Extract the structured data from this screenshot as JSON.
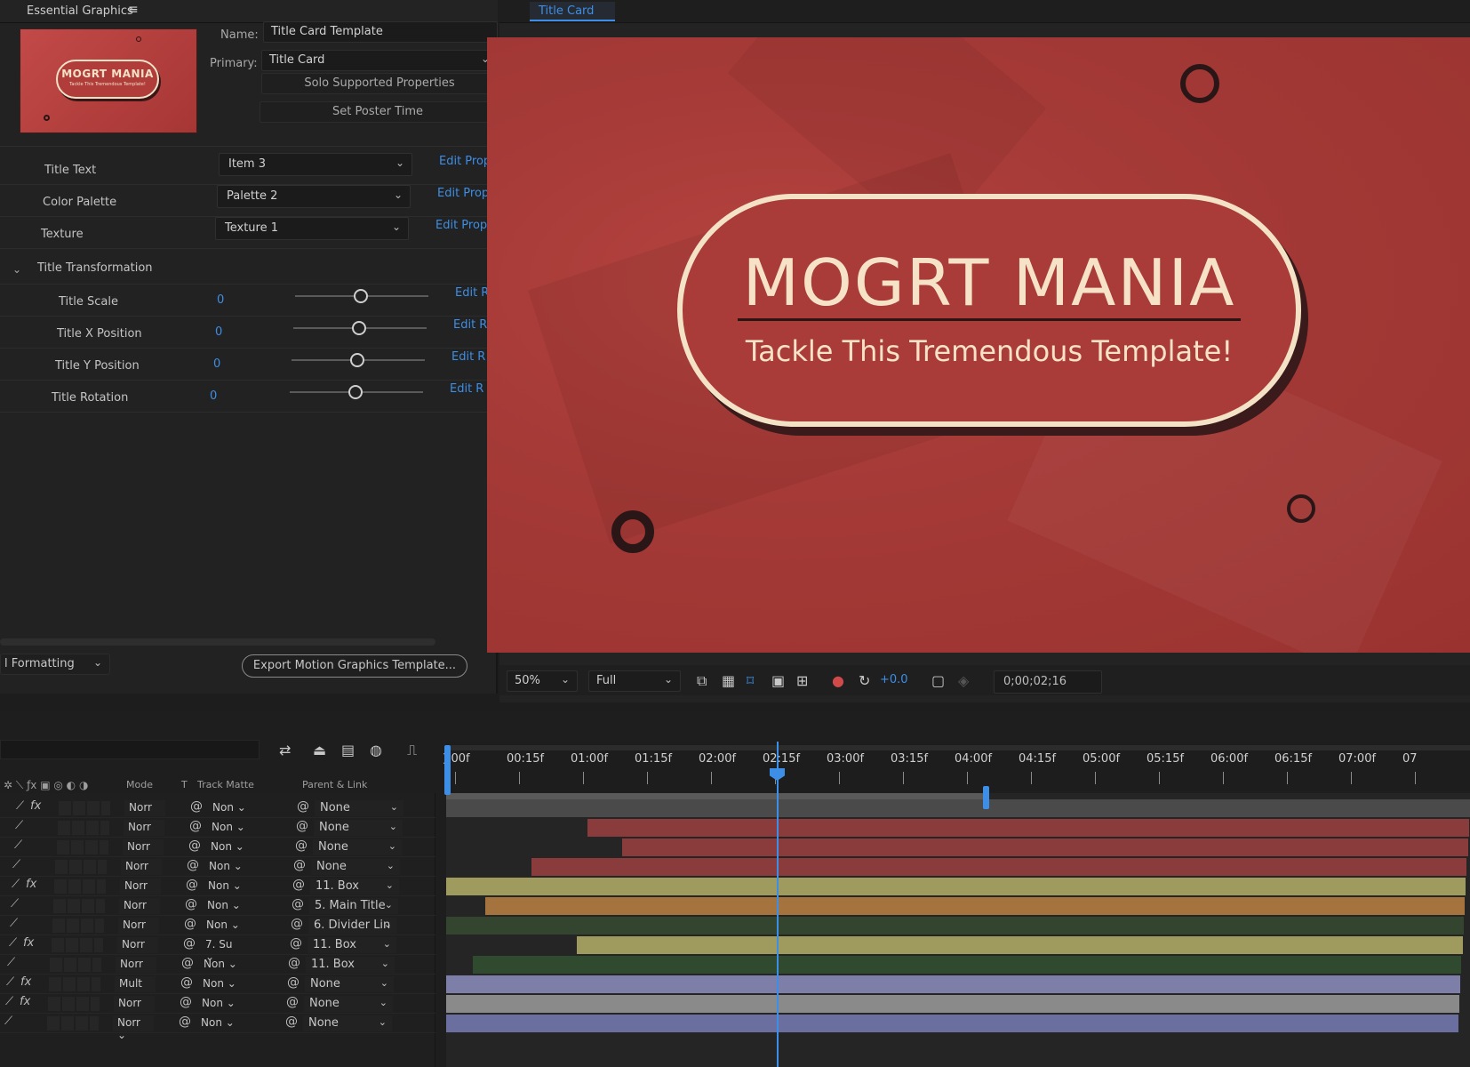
{
  "essential_graphics": {
    "panel_title": "Essential Graphics",
    "menu_icon": "hamburger-icon",
    "thumbnail": {
      "title": "MOGRT MANIA",
      "subtitle": "Tackle This Tremendous Template!"
    },
    "name_label": "Name:",
    "name_value": "Title Card Template",
    "primary_label": "Primary:",
    "primary_value": "Title Card",
    "solo_button": "Solo Supported Properties",
    "poster_button": "Set Poster Time",
    "properties": [
      {
        "name": "Title Text",
        "value": "Item 3",
        "link": "Edit Prope"
      },
      {
        "name": "Color Palette",
        "value": "Palette 2",
        "link": "Edit Prope"
      },
      {
        "name": "Texture",
        "value": "Texture 1",
        "link": "Edit Prope"
      }
    ],
    "group_label": "Title Transformation",
    "sliders": [
      {
        "name": "Title Scale",
        "value": "0",
        "link": "Edit R"
      },
      {
        "name": "Title X Position",
        "value": "0",
        "link": "Edit R"
      },
      {
        "name": "Title Y Position",
        "value": "0",
        "link": "Edit R"
      },
      {
        "name": "Title Rotation",
        "value": "0",
        "link": "Edit R"
      }
    ],
    "formatting_dropdown": "l Formatting",
    "export_button": "Export Motion Graphics Template..."
  },
  "viewer": {
    "tab_label": "Title Card",
    "main_title": "MOGRT MANIA",
    "subtitle": "Tackle This Tremendous Template!",
    "zoom": "50%",
    "resolution": "Full",
    "exposure": "+0.0",
    "timecode": "0;00;02;16",
    "colors": {
      "background": "#a93b38",
      "pill_text": "#f6e3c7",
      "accent": "#3d8ee6"
    }
  },
  "timeline": {
    "columns": {
      "mode": "Mode",
      "t": "T",
      "track_matte": "Track Matte",
      "parent": "Parent & Link"
    },
    "ticks": [
      "):00f",
      "00:15f",
      "01:00f",
      "01:15f",
      "02:00f",
      "02:15f",
      "03:00f",
      "03:15f",
      "04:00f",
      "04:15f",
      "05:00f",
      "05:15f",
      "06:00f",
      "06:15f",
      "07:00f",
      "07"
    ],
    "layers": [
      {
        "fx": "fx",
        "mode": "Norr",
        "matte": "Non",
        "parent": "None",
        "color": "#4a4a4a",
        "start": 0
      },
      {
        "fx": "",
        "mode": "Norr",
        "matte": "Non",
        "parent": "None",
        "color": "#8a3b3b",
        "start": 160
      },
      {
        "fx": "",
        "mode": "Norr",
        "matte": "Non",
        "parent": "None",
        "color": "#8a3b3b",
        "start": 200
      },
      {
        "fx": "",
        "mode": "Norr",
        "matte": "Non",
        "parent": "None",
        "color": "#8a3b3b",
        "start": 100
      },
      {
        "fx": "fx",
        "mode": "Norr",
        "matte": "Non",
        "parent": "11. Box",
        "color": "#9f9a5e",
        "start": 0
      },
      {
        "fx": "",
        "mode": "Norr",
        "matte": "Non",
        "parent": "5. Main Title",
        "color": "#a5743e",
        "start": 50
      },
      {
        "fx": "",
        "mode": "Norr",
        "matte": "Non",
        "parent": "6. Divider Lin",
        "color": "#33442f",
        "start": 0
      },
      {
        "fx": "fx",
        "mode": "Norr",
        "matte": "7. Su",
        "parent": "11. Box",
        "color": "#9f9a5e",
        "start": 155
      },
      {
        "fx": "",
        "mode": "Norr",
        "matte": "Non",
        "parent": "11. Box",
        "color": "#2f4a2f",
        "start": 40
      },
      {
        "fx": "fx",
        "mode": "Mult",
        "matte": "Non",
        "parent": "None",
        "color": "#7e7fa8",
        "start": 0
      },
      {
        "fx": "fx",
        "mode": "Norr",
        "matte": "Non",
        "parent": "None",
        "color": "#8a8a8a",
        "start": 0
      },
      {
        "fx": "",
        "mode": "Norr",
        "matte": "Non",
        "parent": "None",
        "color": "#6a6fa0",
        "start": 0
      }
    ]
  }
}
